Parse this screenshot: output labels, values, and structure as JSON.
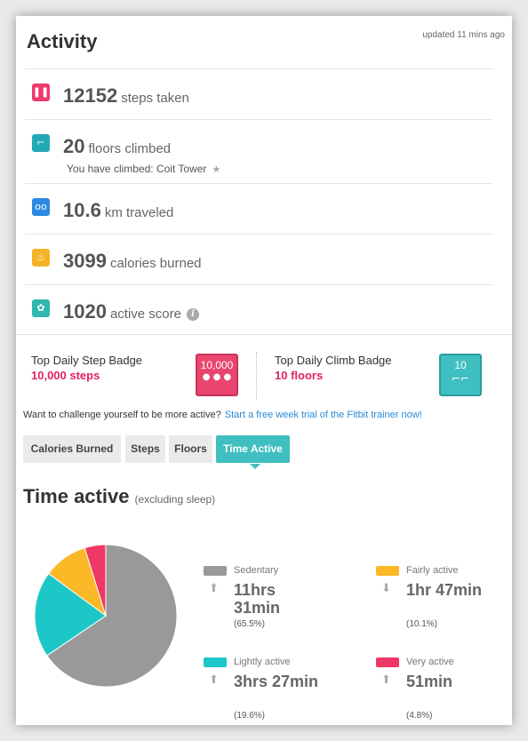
{
  "header": {
    "title": "Activity",
    "updated": "updated 11 mins ago"
  },
  "stats": [
    {
      "icon": "footsteps-icon",
      "value": "12152",
      "unit": "steps taken",
      "color": "#ee3a6a"
    },
    {
      "icon": "stairs-icon",
      "value": "20",
      "unit": "floors climbed",
      "sub": "You have climbed: Coit Tower",
      "color": "#23a9b4"
    },
    {
      "icon": "distance-icon",
      "value": "10.6",
      "unit": "km traveled",
      "color": "#2b8ae0"
    },
    {
      "icon": "flame-icon",
      "value": "3099",
      "unit": "calories burned",
      "color": "#f5b428"
    },
    {
      "icon": "flower-icon",
      "value": "1020",
      "unit": "active score",
      "color": "#2fb7b0"
    }
  ],
  "badges": [
    {
      "label": "Top Daily Step Badge",
      "value": "10,000 steps",
      "badge_text": "10,000",
      "color": "#e9456e"
    },
    {
      "label": "Top Daily Climb Badge",
      "value": "10 floors",
      "badge_text": "10",
      "color": "#3fbfbf"
    }
  ],
  "challenge": {
    "text": "Want to challenge yourself to be more active?",
    "link": "Start a free week trial of the Fitbit trainer now!"
  },
  "tabs": [
    "Calories Burned",
    "Steps",
    "Floors",
    "Time Active"
  ],
  "active_tab": "Time Active",
  "section": {
    "title": "Time active",
    "subtitle": "(excluding sleep)"
  },
  "time_active": [
    {
      "label": "Sedentary",
      "time": "11hrs 31min",
      "pct": "(65.5%)",
      "value": 65.5,
      "color": "#999999",
      "trend": "up"
    },
    {
      "label": "Fairly active",
      "time": "1hr 47min",
      "pct": "(10.1%)",
      "value": 10.1,
      "color": "#fbb827",
      "trend": "down"
    },
    {
      "label": "Lightly active",
      "time": "3hrs 27min",
      "pct": "(19.6%)",
      "value": 19.6,
      "color": "#1ec7c7",
      "trend": "up"
    },
    {
      "label": "Very active",
      "time": "51min",
      "pct": "(4.8%)",
      "value": 4.8,
      "color": "#f03866",
      "trend": "up"
    }
  ]
}
